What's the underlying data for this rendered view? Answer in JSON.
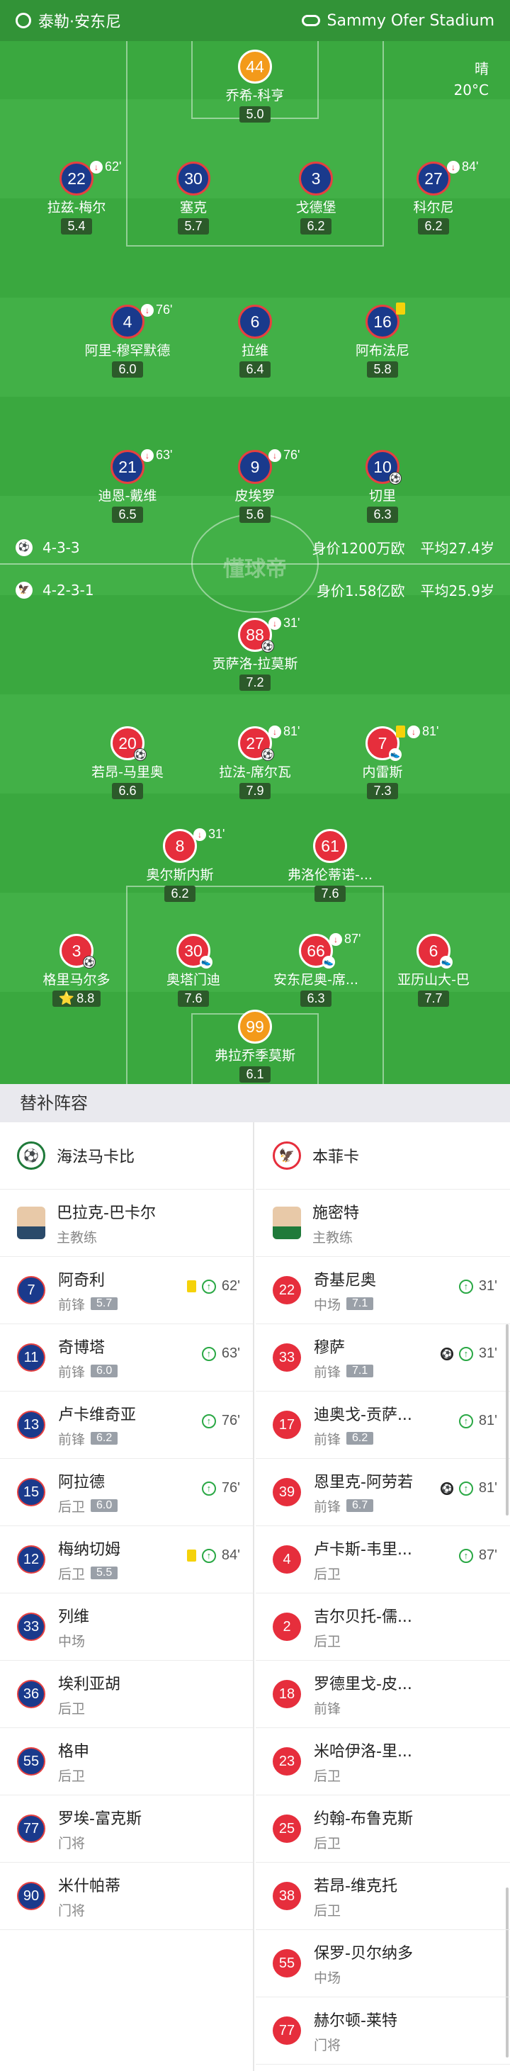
{
  "header": {
    "home_team": "泰勒·安东尼",
    "stadium": "Sammy Ofer Stadium"
  },
  "weather": {
    "condition": "晴",
    "temperature": "20°C"
  },
  "home_team_info": {
    "formation": "4-3-3",
    "value": "身价1200万欧",
    "avg_age": "平均27.4岁"
  },
  "away_team_info": {
    "formation": "4-2-3-1",
    "value": "身价1.58亿欧",
    "avg_age": "平均25.9岁"
  },
  "watermark": "懂球帝",
  "home_players": [
    {
      "num": "44",
      "name": "乔希-科亨",
      "rating": "5.0",
      "style": "orange"
    },
    {
      "num": "22",
      "name": "拉兹-梅尔",
      "rating": "5.4",
      "style": "blue",
      "sub": "62'"
    },
    {
      "num": "30",
      "name": "塞克",
      "rating": "5.7",
      "style": "blue"
    },
    {
      "num": "3",
      "name": "戈德堡",
      "rating": "6.2",
      "style": "blue"
    },
    {
      "num": "27",
      "name": "科尔尼",
      "rating": "6.2",
      "style": "blue",
      "sub": "84'"
    },
    {
      "num": "4",
      "name": "阿里-穆罕默德",
      "rating": "6.0",
      "style": "blue",
      "sub": "76'"
    },
    {
      "num": "6",
      "name": "拉维",
      "rating": "6.4",
      "style": "blue"
    },
    {
      "num": "16",
      "name": "阿布法尼",
      "rating": "5.8",
      "style": "blue",
      "card": "yellow"
    },
    {
      "num": "21",
      "name": "迪恩-戴维",
      "rating": "6.5",
      "style": "blue",
      "sub": "63'"
    },
    {
      "num": "9",
      "name": "皮埃罗",
      "rating": "5.6",
      "style": "blue",
      "sub": "76'"
    },
    {
      "num": "10",
      "name": "切里",
      "rating": "6.3",
      "style": "blue",
      "goal": "ball-icon"
    }
  ],
  "away_players": [
    {
      "num": "88",
      "name": "贡萨洛-拉莫斯",
      "rating": "7.2",
      "style": "red",
      "sub": "31'",
      "goal": "ball-icon"
    },
    {
      "num": "20",
      "name": "若昂-马里奥",
      "rating": "6.6",
      "style": "red",
      "goal": "ball-icon"
    },
    {
      "num": "27",
      "name": "拉法-席尔瓦",
      "rating": "7.9",
      "style": "red",
      "sub": "81'",
      "goal": "ball-icon"
    },
    {
      "num": "7",
      "name": "内雷斯",
      "rating": "7.3",
      "style": "red",
      "card": "yellow",
      "sub": "81'",
      "assist": "boot-icon"
    },
    {
      "num": "8",
      "name": "奥尔斯内斯",
      "rating": "6.2",
      "style": "red",
      "sub": "31'"
    },
    {
      "num": "61",
      "name": "弗洛伦蒂诺-...",
      "rating": "7.6",
      "style": "red"
    },
    {
      "num": "3",
      "name": "格里马尔多",
      "rating": "8.8",
      "style": "red",
      "goal": "ball-icon",
      "star": "star-icon"
    },
    {
      "num": "30",
      "name": "奥塔门迪",
      "rating": "7.6",
      "style": "red",
      "assist": "boot-icon"
    },
    {
      "num": "66",
      "name": "安东尼奥-席...",
      "rating": "6.3",
      "style": "red",
      "sub": "87'",
      "assist": "boot-icon"
    },
    {
      "num": "6",
      "name": "亚历山大-巴",
      "rating": "7.7",
      "style": "red",
      "assist": "boot-icon"
    },
    {
      "num": "99",
      "name": "弗拉乔季莫斯",
      "rating": "6.1",
      "style": "orange"
    }
  ],
  "subs": {
    "title": "替补阵容",
    "left": {
      "team": "海法马卡比",
      "coach": {
        "name": "巴拉克-巴卡尔",
        "role": "主教练"
      },
      "players": [
        {
          "num": "7",
          "name": "阿奇利",
          "pos": "前锋",
          "rating": "5.7",
          "card": "yellow",
          "sub": "62'"
        },
        {
          "num": "11",
          "name": "奇博塔",
          "pos": "前锋",
          "rating": "6.0",
          "sub": "63'"
        },
        {
          "num": "13",
          "name": "卢卡维奇亚",
          "pos": "前锋",
          "rating": "6.2",
          "sub": "76'"
        },
        {
          "num": "15",
          "name": "阿拉德",
          "pos": "后卫",
          "rating": "6.0",
          "sub": "76'"
        },
        {
          "num": "12",
          "name": "梅纳切姆",
          "pos": "后卫",
          "rating": "5.5",
          "card": "yellow",
          "sub": "84'"
        },
        {
          "num": "33",
          "name": "列维",
          "pos": "中场"
        },
        {
          "num": "36",
          "name": "埃利亚胡",
          "pos": "后卫"
        },
        {
          "num": "55",
          "name": "格申",
          "pos": "后卫"
        },
        {
          "num": "77",
          "name": "罗埃-富克斯",
          "pos": "门将"
        },
        {
          "num": "90",
          "name": "米什帕蒂",
          "pos": "门将"
        }
      ]
    },
    "right": {
      "team": "本菲卡",
      "coach": {
        "name": "施密特",
        "role": "主教练"
      },
      "players": [
        {
          "num": "22",
          "name": "奇基尼奥",
          "pos": "中场",
          "rating": "7.1",
          "sub": "31'"
        },
        {
          "num": "33",
          "name": "穆萨",
          "pos": "前锋",
          "rating": "7.1",
          "goal": "ball-icon",
          "sub": "31'"
        },
        {
          "num": "17",
          "name": "迪奥戈-贡萨...",
          "pos": "前锋",
          "rating": "6.2",
          "sub": "81'"
        },
        {
          "num": "39",
          "name": "恩里克-阿劳若",
          "pos": "前锋",
          "rating": "6.7",
          "goal": "ball-icon",
          "sub": "81'"
        },
        {
          "num": "4",
          "name": "卢卡斯-韦里...",
          "pos": "后卫",
          "sub": "87'"
        },
        {
          "num": "2",
          "name": "吉尔贝托-儒...",
          "pos": "后卫"
        },
        {
          "num": "18",
          "name": "罗德里戈-皮...",
          "pos": "前锋"
        },
        {
          "num": "23",
          "name": "米哈伊洛-里...",
          "pos": "后卫"
        },
        {
          "num": "25",
          "name": "约翰-布鲁克斯",
          "pos": "后卫"
        },
        {
          "num": "38",
          "name": "若昂-维克托",
          "pos": "后卫"
        },
        {
          "num": "55",
          "name": "保罗-贝尔纳多",
          "pos": "中场"
        },
        {
          "num": "77",
          "name": "赫尔顿-莱特",
          "pos": "门将"
        }
      ]
    }
  }
}
